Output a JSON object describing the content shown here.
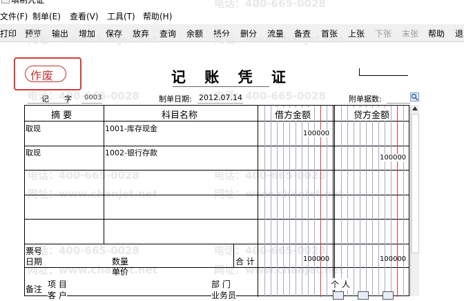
{
  "window": {
    "title": "填制凭证"
  },
  "menu": [
    "文件(F)",
    "制单(E)",
    "查看(V)",
    "工具(T)",
    "帮助(H)"
  ],
  "toolbar": {
    "buttons": [
      "打印",
      "预览",
      "输出",
      "增加",
      "保存",
      "放弃",
      "查询",
      "余额",
      "插分",
      "删分",
      "流量",
      "备查",
      "首张",
      "上张",
      "下张",
      "末张",
      "帮助",
      "退"
    ],
    "disabled": [
      "下张",
      "末张"
    ]
  },
  "watermark": {
    "phone": "电话：400-665-0028",
    "site": "网址：www.chanjet.net"
  },
  "voucher": {
    "status_stamp": "作废",
    "title": "记 账 凭 证",
    "type_label": "记",
    "zi_label": "字",
    "number": "0003",
    "date_label": "制单日期:",
    "date": "2012.07.14",
    "attachments_label": "附单据数:"
  },
  "table": {
    "headers": {
      "summary": "摘 要",
      "account": "科目名称",
      "debit": "借方金额",
      "credit": "贷方金额"
    },
    "rows": [
      {
        "summary": "取现",
        "account": "1001-库存现金",
        "debit": "100000",
        "credit": ""
      },
      {
        "summary": "取现",
        "account": "1002-银行存款",
        "debit": "",
        "credit": "100000"
      },
      {
        "summary": "",
        "account": "",
        "debit": "",
        "credit": ""
      },
      {
        "summary": "",
        "account": "",
        "debit": "",
        "credit": ""
      },
      {
        "summary": "",
        "account": "",
        "debit": "",
        "credit": ""
      }
    ],
    "footer": {
      "ticket_no_label": "票号",
      "date_label": "日期",
      "quantity_label": "数量",
      "unit_price_label": "单价",
      "total_label": "合 计",
      "total_debit": "100000",
      "total_credit": "100000"
    },
    "remarks": {
      "label": "备注",
      "project_label": "项 目",
      "customer_label": "客 户",
      "department_label": "部 门",
      "salesperson_label": "业务员",
      "person_label": "个 人"
    }
  }
}
